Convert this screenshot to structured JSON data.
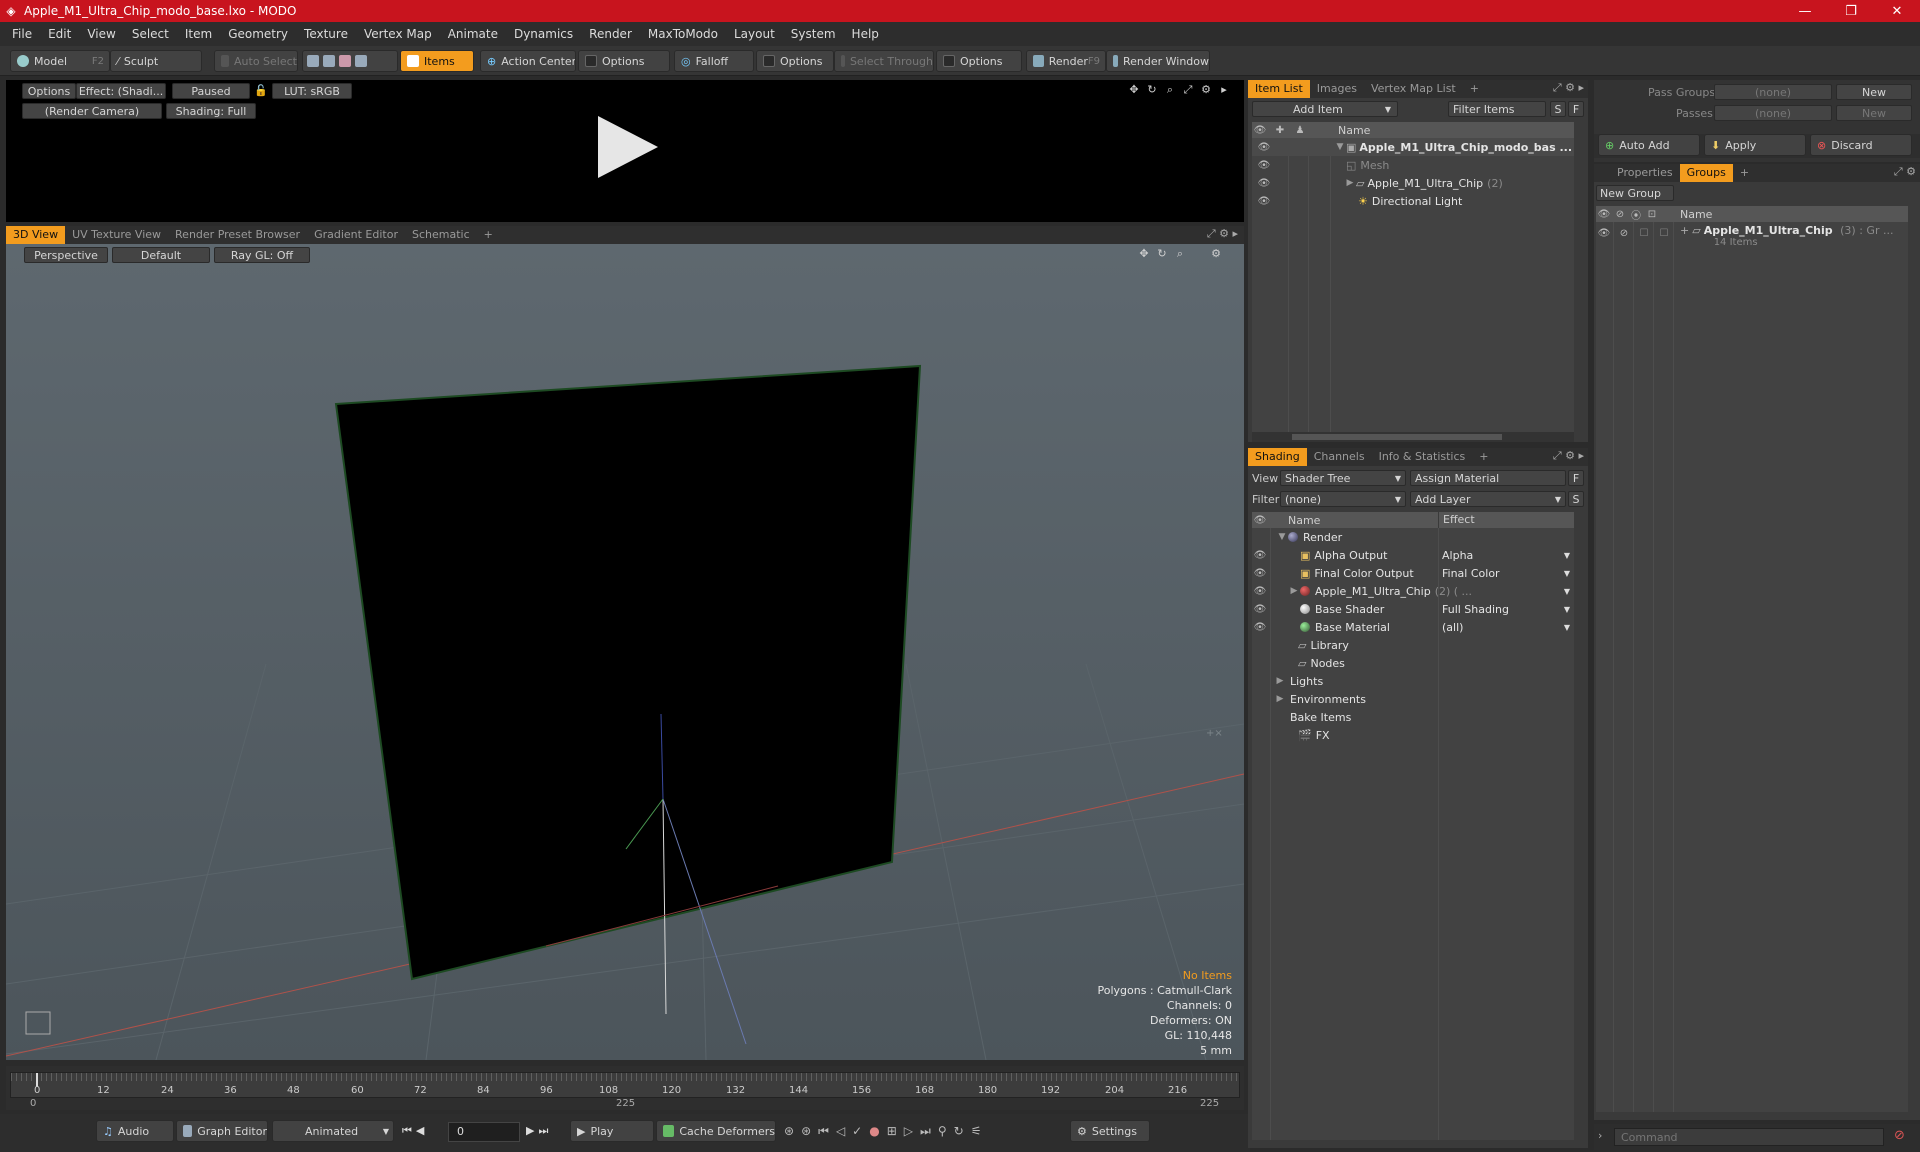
{
  "window": {
    "title": "Apple_M1_Ultra_Chip_modo_base.lxo - MODO",
    "buttons": [
      "—",
      "❐",
      "✕"
    ]
  },
  "menu": [
    "File",
    "Edit",
    "View",
    "Select",
    "Item",
    "Geometry",
    "Texture",
    "Vertex Map",
    "Animate",
    "Dynamics",
    "Render",
    "MaxToModo",
    "Layout",
    "System",
    "Help"
  ],
  "toolbar": {
    "model": "Model",
    "model_shortcut": "F2",
    "sculpt": "Sculpt",
    "auto_select": "Auto Select",
    "items": "Items",
    "action_center": "Action Center",
    "options1": "Options",
    "falloff": "Falloff",
    "options2": "Options",
    "select_through": "Select Through",
    "options3": "Options",
    "render": "Render",
    "render_shortcut": "F9",
    "render_window": "Render Window"
  },
  "preview": {
    "options": "Options",
    "effect": "Effect: (Shadi...",
    "paused": "Paused",
    "lut": "LUT: sRGB",
    "camera": "(Render Camera)",
    "shading": "Shading: Full"
  },
  "viewport": {
    "tabs": [
      "3D View",
      "UV Texture View",
      "Render Preset Browser",
      "Gradient Editor",
      "Schematic"
    ],
    "perspective": "Perspective",
    "default": "Default",
    "raygl": "Ray GL: Off",
    "info": {
      "no_items": "No Items",
      "polygons": "Polygons : Catmull-Clark",
      "channels": "Channels: 0",
      "deformers": "Deformers: ON",
      "gl": "GL: 110,448",
      "scale": "5 mm"
    }
  },
  "timeline": {
    "ticks": [
      "0",
      "12",
      "24",
      "36",
      "48",
      "60",
      "72",
      "84",
      "96",
      "108",
      "120",
      "132",
      "144",
      "156",
      "168",
      "180",
      "192",
      "204",
      "216"
    ],
    "start": "0",
    "mid": "225",
    "end": "225"
  },
  "bottom_bar": {
    "audio": "Audio",
    "graph_editor": "Graph Editor",
    "animated": "Animated",
    "frame": "0",
    "play": "Play",
    "cache_deformers": "Cache Deformers",
    "settings": "Settings"
  },
  "item_list": {
    "tabs": [
      "Item List",
      "Images",
      "Vertex Map List"
    ],
    "add_item": "Add Item",
    "filter_items": "Filter Items",
    "s": "S",
    "f": "F",
    "col_name": "Name",
    "rows": [
      {
        "label": "Apple_M1_Ultra_Chip_modo_bas ...",
        "count": ""
      },
      {
        "label": "Mesh",
        "count": ""
      },
      {
        "label": "Apple_M1_Ultra_Chip",
        "count": "(2)"
      },
      {
        "label": "Directional Light",
        "count": ""
      }
    ]
  },
  "shading": {
    "tabs": [
      "Shading",
      "Channels",
      "Info & Statistics"
    ],
    "view_label": "View",
    "view_value": "Shader Tree",
    "assign_material": "Assign Material",
    "filter_label": "Filter",
    "filter_value": "(none)",
    "add_layer": "Add Layer",
    "f": "F",
    "s": "S",
    "col_name": "Name",
    "col_effect": "Effect",
    "rows": [
      {
        "label": "Render",
        "count": "",
        "effect": ""
      },
      {
        "label": "Alpha Output",
        "count": "",
        "effect": "Alpha"
      },
      {
        "label": "Final Color Output",
        "count": "",
        "effect": "Final Color"
      },
      {
        "label": "Apple_M1_Ultra_Chip",
        "count": "(2) ( ...",
        "effect": ""
      },
      {
        "label": "Base Shader",
        "count": "",
        "effect": "Full Shading"
      },
      {
        "label": "Base Material",
        "count": "",
        "effect": "(all)"
      },
      {
        "label": "Library",
        "count": "",
        "effect": ""
      },
      {
        "label": "Nodes",
        "count": "",
        "effect": ""
      },
      {
        "label": "Lights",
        "count": "",
        "effect": ""
      },
      {
        "label": "Environments",
        "count": "",
        "effect": ""
      },
      {
        "label": "Bake Items",
        "count": "",
        "effect": ""
      },
      {
        "label": "FX",
        "count": "",
        "effect": ""
      }
    ]
  },
  "pass": {
    "pass_groups": "Pass Groups",
    "passes": "Passes",
    "none1": "(none)",
    "none2": "(none)",
    "new1": "New",
    "new2": "New",
    "auto_add": "Auto Add",
    "apply": "Apply",
    "discard": "Discard"
  },
  "groups": {
    "tabs": [
      "Properties",
      "Groups"
    ],
    "new_group": "New Group",
    "col_name": "Name",
    "group_name": "Apple_M1_Ultra_Chip",
    "group_suffix": "(3) : Gr ...",
    "group_items": "14 Items"
  },
  "command": {
    "placeholder": "Command"
  },
  "colors": {
    "accent": "#f39c1e",
    "titlebar": "#c8141e"
  }
}
